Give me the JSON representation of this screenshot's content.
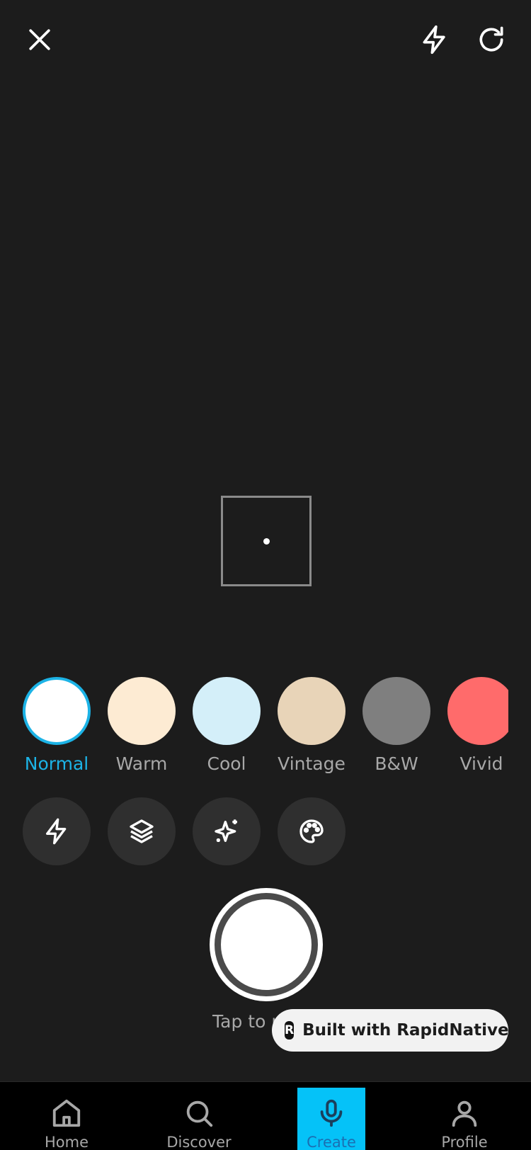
{
  "header": {
    "close_icon": "close-icon",
    "flash_icon": "flash-icon",
    "flip_icon": "flip-camera-icon"
  },
  "filters": [
    {
      "label": "Normal",
      "color": "#ffffff",
      "selected": true
    },
    {
      "label": "Warm",
      "color": "#fdebd3"
    },
    {
      "label": "Cool",
      "color": "#d4eff9"
    },
    {
      "label": "Vintage",
      "color": "#e8d4b8"
    },
    {
      "label": "B&W",
      "color": "#7f7f7f"
    },
    {
      "label": "Vivid",
      "color": "#ff6b6b"
    }
  ],
  "tools": [
    "flash-icon",
    "layers-icon",
    "sparkles-icon",
    "palette-icon"
  ],
  "hint": "Tap to record",
  "badge": {
    "logo": "R",
    "text": "Built with RapidNative"
  },
  "tabs": [
    {
      "label": "Home",
      "icon": "home-icon"
    },
    {
      "label": "Discover",
      "icon": "search-icon"
    },
    {
      "label": "Create",
      "icon": "microphone-icon",
      "active": true
    },
    {
      "label": "Profile",
      "icon": "user-icon"
    }
  ],
  "colors": {
    "accent": "#1cb3e6",
    "active_tab_bg": "#05c2f8",
    "background": "#1c1c1c"
  }
}
